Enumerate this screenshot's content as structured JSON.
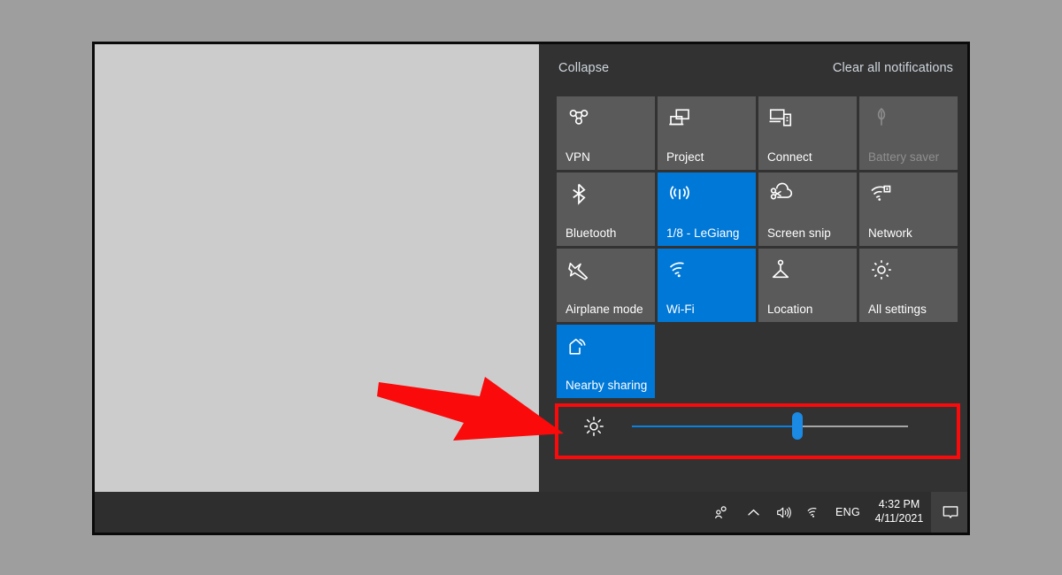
{
  "window": {
    "name": "windows-10-desktop-screenshot"
  },
  "action_center": {
    "collapse_label": "Collapse",
    "clear_all_label": "Clear all notifications",
    "accent_color": "#0078d7",
    "panel_color": "#323232",
    "tile_color": "#5a5a5a",
    "tiles": [
      {
        "label": "VPN",
        "icon": "vpn-icon",
        "state": "off"
      },
      {
        "label": "Project",
        "icon": "project-icon",
        "state": "off"
      },
      {
        "label": "Connect",
        "icon": "connect-icon",
        "state": "off"
      },
      {
        "label": "Battery saver",
        "icon": "battery-saver-icon",
        "state": "disabled"
      },
      {
        "label": "Bluetooth",
        "icon": "bluetooth-icon",
        "state": "off"
      },
      {
        "label": "1/8 - LeGiang",
        "icon": "note-icon",
        "state": "on"
      },
      {
        "label": "Screen snip",
        "icon": "screen-snip-icon",
        "state": "off"
      },
      {
        "label": "Network",
        "icon": "network-icon",
        "state": "off"
      },
      {
        "label": "Airplane mode",
        "icon": "airplane-icon",
        "state": "off"
      },
      {
        "label": "Wi-Fi",
        "icon": "wifi-icon",
        "state": "on"
      },
      {
        "label": "Location",
        "icon": "location-icon",
        "state": "off"
      },
      {
        "label": "All settings",
        "icon": "gear-icon",
        "state": "off"
      },
      {
        "label": "Nearby sharing",
        "icon": "nearby-sharing-icon",
        "state": "on"
      }
    ],
    "brightness": {
      "icon": "brightness-icon",
      "value_percent": 60,
      "min": 0,
      "max": 100
    }
  },
  "annotation": {
    "arrow": {
      "name": "red-arrow-pointer",
      "color": "#fa0a0a",
      "direction": "right"
    },
    "highlight": {
      "name": "red-highlight-box",
      "color": "#fa0a0a",
      "targets": "brightness-slider"
    }
  },
  "taskbar": {
    "background_color": "#2e2e2e",
    "people_icon": "people-icon",
    "chevron_icon": "chevron-up-icon",
    "volume_icon": "volume-icon",
    "wifi_icon": "wifi-tray-icon",
    "language": "ENG",
    "clock": {
      "time": "4:32 PM",
      "date": "4/11/2021"
    },
    "notification_icon": "notification-icon"
  }
}
